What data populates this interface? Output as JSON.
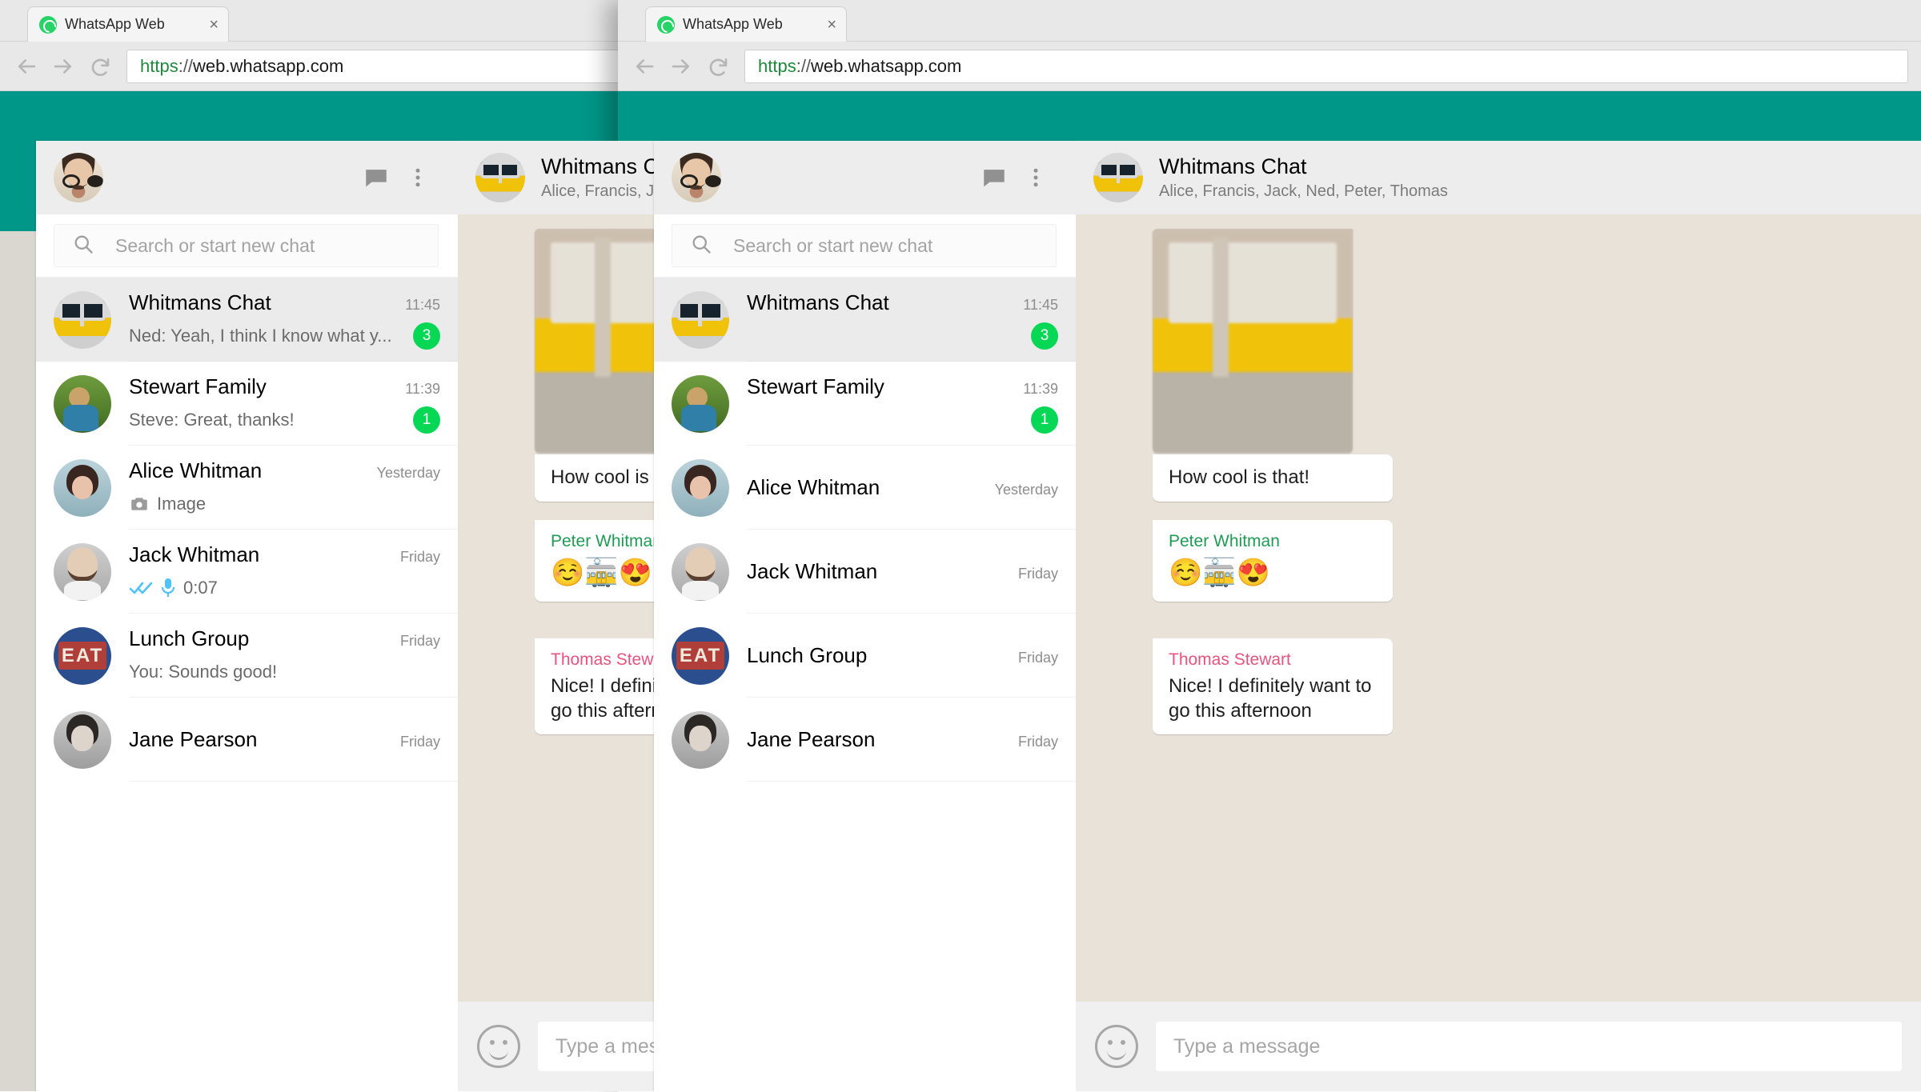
{
  "browser": {
    "tab": {
      "title": "WhatsApp Web",
      "favicon": "whatsapp-icon",
      "close": "×"
    },
    "nav": {
      "back": "back-arrow-icon",
      "forward": "forward-arrow-icon",
      "reload": "reload-icon"
    },
    "url": {
      "scheme": "https",
      "separator": "://",
      "host": "web.whatsapp.com",
      "full": "https://web.whatsapp.com"
    },
    "colors": {
      "accent_teal": "#009688",
      "brand_green": "#25d366",
      "badge_green": "#06d755",
      "url_scheme_green": "#1d8a3b"
    }
  },
  "app": {
    "header": {
      "avatar": "user-avatar",
      "new_chat_icon": "new-chat-icon",
      "menu_icon": "overflow-menu-icon"
    },
    "search": {
      "icon": "search-icon",
      "placeholder": "Search or start new chat",
      "value": ""
    },
    "chats": [
      {
        "name": "Whitmans Chat",
        "time": "11:45",
        "message": "Ned: Yeah, I think I know what y...",
        "badge": "3",
        "active": true,
        "avatar_class": "av-tram",
        "prefix_icon": ""
      },
      {
        "name": "Stewart Family",
        "time": "11:39",
        "message": "Steve: Great, thanks!",
        "badge": "1",
        "active": false,
        "avatar_class": "av-grass",
        "prefix_icon": ""
      },
      {
        "name": "Alice Whitman",
        "time": "Yesterday",
        "message": "Image",
        "badge": "",
        "active": false,
        "avatar_class": "av-alice",
        "prefix_icon": "camera-icon"
      },
      {
        "name": "Jack Whitman",
        "time": "Friday",
        "message": "0:07",
        "badge": "",
        "active": false,
        "avatar_class": "av-jack",
        "prefix_icon": "double-check-microphone-icon"
      },
      {
        "name": "Lunch Group",
        "time": "Friday",
        "message": "You: Sounds good!",
        "badge": "",
        "active": false,
        "avatar_class": "av-eat",
        "avatar_text": "EAT",
        "prefix_icon": ""
      },
      {
        "name": "Jane Pearson",
        "time": "Friday",
        "message": "",
        "badge": "",
        "active": false,
        "avatar_class": "av-jane",
        "prefix_icon": ""
      }
    ],
    "conversation": {
      "title": "Whitmans Chat",
      "subtitle": "Alice, Francis, Jack, Ned, Peter, Thomas",
      "avatar": "group-avatar-tram",
      "messages": [
        {
          "sender": "",
          "text": "",
          "type": "image"
        },
        {
          "sender": "",
          "text": "How cool is that!",
          "type": "text"
        },
        {
          "sender": "Peter Whitman",
          "text": "☺️🚋😍",
          "type": "emoji"
        },
        {
          "sender": "Thomas Stewart",
          "text": "Nice! I definitely want to go this afternoon",
          "type": "text"
        }
      ],
      "footer": {
        "emoji_icon": "emoji-smiley-icon",
        "input_placeholder": "Type a message",
        "input_value": ""
      }
    }
  }
}
